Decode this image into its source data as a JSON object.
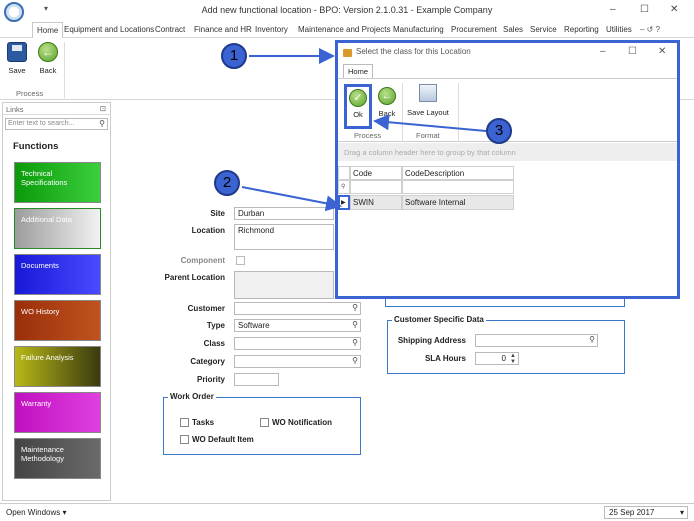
{
  "window": {
    "title": "Add new functional location - BPO: Version 2.1.0.31 - Example Company",
    "minimize": "–",
    "maximize": "☐",
    "close": "✕"
  },
  "menu": {
    "arrow": "▾",
    "items": [
      "Home",
      "Equipment and Locations",
      "Contract",
      "Finance and HR",
      "Inventory",
      "Maintenance and Projects",
      "Manufacturing",
      "Procurement",
      "Sales",
      "Service",
      "Reporting",
      "Utilities"
    ],
    "right_controls": "– ↺ ?"
  },
  "ribbon": {
    "save_label": "Save",
    "back_label": "Back",
    "group_label": "Process"
  },
  "links": {
    "header": "Links",
    "pin": "⊡",
    "search_placeholder": "Enter text to search...",
    "functions_title": "Functions",
    "tiles": [
      {
        "label": "Technical Specifications",
        "color": "#1aa81a"
      },
      {
        "label": "Additional Data",
        "color": "#b0b0b0"
      },
      {
        "label": "Documents",
        "color": "#1a1aee"
      },
      {
        "label": "WO History",
        "color": "#a63a0f"
      },
      {
        "label": "Failure Analysis",
        "color": "#a0a018"
      },
      {
        "label": "Warranty",
        "color": "#cc1acc"
      },
      {
        "label": "Maintenance Methodology",
        "color": "#555555"
      }
    ]
  },
  "form": {
    "site_label": "Site",
    "site_value": "Durban",
    "location_label": "Location",
    "location_value": "Richmond",
    "component_label": "Component",
    "parent_location_label": "Parent Location",
    "customer_label": "Customer",
    "customer_value": "",
    "type_label": "Type",
    "type_value": "Software",
    "class_label": "Class",
    "class_value": "",
    "category_label": "Category",
    "category_value": "",
    "priority_label": "Priority",
    "priority_value": "",
    "work_order_title": "Work Order",
    "tasks_label": "Tasks",
    "wo_notification_label": "WO Notification",
    "wo_default_item_label": "WO Default Item",
    "customer_specific_title": "Customer Specific Data",
    "shipping_address_label": "Shipping Address",
    "shipping_address_value": "",
    "sla_hours_label": "SLA Hours",
    "sla_hours_value": "0"
  },
  "status": {
    "open_windows": "Open Windows ▾",
    "date": "25 Sep 2017"
  },
  "dialog": {
    "title": "Select the class for this Location",
    "tab": "Home",
    "ok_label": "Ok",
    "back_label": "Back",
    "save_layout_label": "Save Layout",
    "process_label": "Process",
    "format_label": "Format",
    "group_hint": "Drag a column header here to group by that column",
    "columns": [
      "Code",
      "CodeDescription"
    ],
    "rows": [
      {
        "code": "SWIN",
        "description": "Software Internal"
      }
    ]
  },
  "callouts": [
    "1",
    "2",
    "3"
  ],
  "colors": {
    "accent": "#3b63d1",
    "form_border": "#3a78c8"
  }
}
